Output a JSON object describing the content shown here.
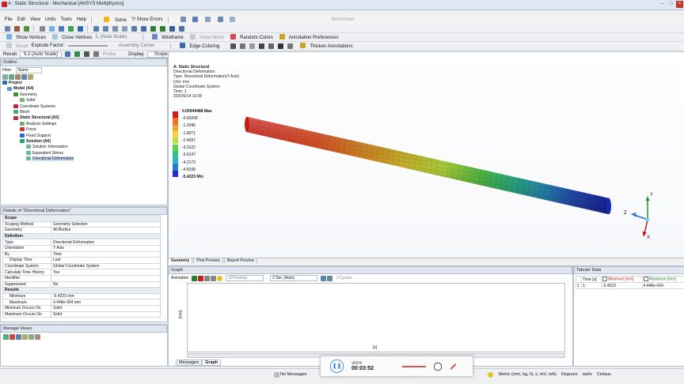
{
  "window": {
    "title": "A : Static Structural - Mechanical [ANSYS Multiphysics]"
  },
  "menu": [
    "File",
    "Edit",
    "View",
    "Units",
    "Tools",
    "Help"
  ],
  "toolbar1": {
    "solve": "Solve",
    "show_errors": "?/ Show Errors",
    "worksheet": "Worksheet"
  },
  "toolbar2": {
    "show_vertices": "Show Vertices",
    "close_vertices": "Close Vertices",
    "auto_scale": "1, (Auto Scale)",
    "wireframe": "Wireframe",
    "show_mesh": "Show Mesh",
    "random_colors": "Random Colors",
    "annotation_prefs": "Annotation Preferences"
  },
  "toolbar3": {
    "explode_factor": "Explode Factor:",
    "reset": "Reset",
    "assembly_center": "Assembly Center",
    "edge_coloring": "Edge Coloring",
    "thicken_annotations": "Thicken Annotations",
    "probe": "Probe"
  },
  "toolbar4": {
    "result_label": "Result",
    "result_value": "9.2 (Auto Scale)",
    "display_label": "Display",
    "display_value": "Scoped Bodies"
  },
  "outline": {
    "header": "Outline",
    "filter_label": "Filter:",
    "filter_value": "Name",
    "items": [
      "Project",
      "Model (A4)",
      "Geometry",
      "Solid",
      "Coordinate Systems",
      "Mesh",
      "Static Structural (A5)",
      "Analysis Settings",
      "Force",
      "Fixed Support",
      "Solution (A6)",
      "Solution Information",
      "Equivalent Stress",
      "Directional Deformation"
    ]
  },
  "details": {
    "header": "Details of \"Directional Deformation\"",
    "sections": [
      {
        "title": "Scope",
        "rows": [
          [
            "Scoping Method",
            "Geometry Selection"
          ],
          [
            "Geometry",
            "All Bodies"
          ]
        ]
      },
      {
        "title": "Definition",
        "rows": [
          [
            "Type",
            "Directional Deformation"
          ],
          [
            "Orientation",
            "Y Axis"
          ],
          [
            "By",
            "Time"
          ],
          [
            "Display Time",
            "Last"
          ],
          [
            "Coordinate System",
            "Global Coordinate System"
          ],
          [
            "Calculate Time History",
            "Yes"
          ],
          [
            "Identifier",
            ""
          ],
          [
            "Suppressed",
            "No"
          ]
        ]
      },
      {
        "title": "Results",
        "rows": [
          [
            "Minimum",
            "-5.4223 mm"
          ],
          [
            "Maximum",
            "4.448e-004 mm"
          ],
          [
            "Minimum Occurs On",
            "Solid"
          ],
          [
            "Maximum Occurs On",
            "Solid"
          ]
        ]
      }
    ]
  },
  "manage_views": {
    "header": "Manage Views"
  },
  "viewport": {
    "info": [
      "A: Static Structural",
      "Directional Deformation",
      "Type: Directional Deformation(Y Axis)",
      "Unit: mm",
      "Global Coordinate System",
      "Time: 1",
      "2020/6/14 15:05"
    ],
    "legend": {
      "labels": [
        "0.00044488 Max",
        "-0.60208",
        "-1.2046",
        "-1.8071",
        "-2.4097",
        "-3.0122",
        "-3.6147",
        "-4.2173",
        "-4.8198",
        "-5.4223 Min"
      ],
      "colors": [
        "#d7191c",
        "#f46d2a",
        "#f7a12e",
        "#f0d43a",
        "#b9e34a",
        "#62d14e",
        "#34c28b",
        "#2fb6c6",
        "#2a7bd6",
        "#1f2fd1"
      ]
    },
    "axis": {
      "x": "X",
      "y": "Y",
      "z": "Z"
    }
  },
  "view_tabs": [
    "Geometry",
    "Print Preview",
    "Report Preview"
  ],
  "graph": {
    "header": "Graph",
    "animation_label": "Animation",
    "frames": "10 Frames",
    "duration": "2 Sec (Auto)",
    "cycles": "3 Cycles",
    "ylabel": "[mm]",
    "xlabel": "[s]"
  },
  "bottom_tabs": [
    "Messages",
    "Graph"
  ],
  "tabular": {
    "header": "Tabular Data",
    "columns": [
      "Time [s]",
      "Minimum [mm]",
      "Maximum [mm]"
    ],
    "rows": [
      [
        "1",
        "1.",
        "-5.4223",
        "4.448e-004"
      ]
    ]
  },
  "player": {
    "time": "00:03:52",
    "label": "录制中"
  },
  "status": {
    "messages": "No Messages",
    "units": "Metric (mm, kg, N, s, mV, mA)",
    "degrees": "Degrees",
    "rads": "rad/s",
    "celsius": "Celsius"
  }
}
